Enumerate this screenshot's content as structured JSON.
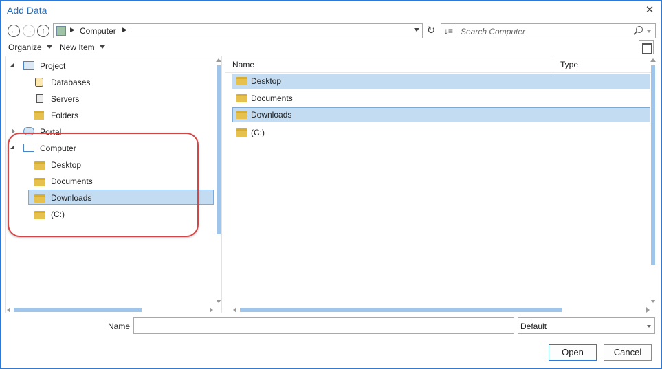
{
  "window": {
    "title": "Add Data",
    "close_glyph": "✕"
  },
  "navigation": {
    "back_glyph": "←",
    "forward_glyph": "→",
    "up_glyph": "↑",
    "path_segment": "Computer",
    "refresh_glyph": "↻",
    "sort_glyph": "↓≡",
    "search_placeholder": "Search Computer"
  },
  "toolbar": {
    "organize_label": "Organize",
    "new_item_label": "New Item"
  },
  "tree": {
    "project": "Project",
    "databases": "Databases",
    "servers": "Servers",
    "folders": "Folders",
    "portal": "Portal",
    "computer": "Computer",
    "desktop": "Desktop",
    "documents": "Documents",
    "downloads": "Downloads",
    "c_drive": "(C:)",
    "selected_item": "Downloads"
  },
  "file_list": {
    "columns": {
      "name": "Name",
      "type": "Type"
    },
    "rows": [
      {
        "name": "Desktop",
        "state": "selected"
      },
      {
        "name": "Documents",
        "state": "normal"
      },
      {
        "name": "Downloads",
        "state": "selected-focused"
      },
      {
        "name": "(C:)",
        "state": "normal"
      }
    ]
  },
  "footer": {
    "name_label": "Name",
    "name_value": "",
    "format_value": "Default",
    "open_label": "Open",
    "cancel_label": "Cancel"
  },
  "colors": {
    "accent": "#2b7ad6",
    "selection": "#c4dcf1",
    "highlight_ring": "#d64545",
    "folder": "#e7c14d"
  }
}
